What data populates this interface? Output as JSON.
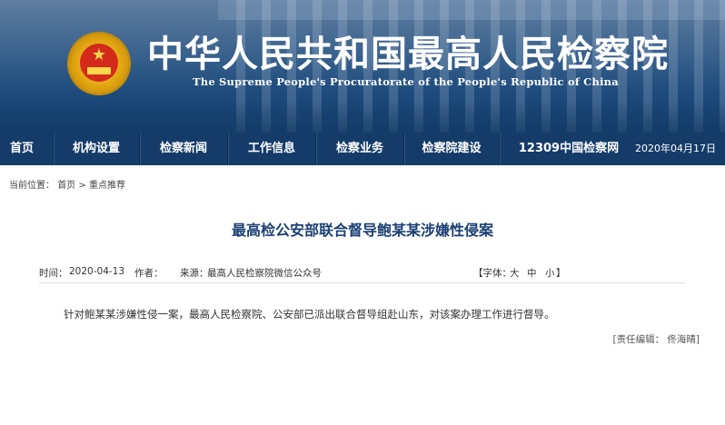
{
  "header": {
    "title": "中华人民共和国最高人民检察院",
    "subtitle": "The Supreme People's Procuratorate of the People's Republic of China",
    "emblem_icon": "procuratorate-emblem-icon"
  },
  "nav": {
    "items": [
      {
        "label": "首页"
      },
      {
        "label": "机构设置"
      },
      {
        "label": "检察新闻"
      },
      {
        "label": "工作信息"
      },
      {
        "label": "检察业务"
      },
      {
        "label": "检察院建设"
      },
      {
        "label": "12309中国检察网"
      }
    ],
    "date": "2020年04月17日"
  },
  "breadcrumb": {
    "prefix": "当前位置：",
    "home": "首页",
    "sep": ">",
    "current": "重点推荐"
  },
  "article": {
    "title": "最高检公安部联合督导鲍某某涉嫌性侵案",
    "time_label": "时间：",
    "time": "2020-04-13",
    "author_label": "作者：",
    "source_label": "来源：",
    "source": "最高人民检察院微信公众号",
    "font": {
      "open": "【字体：",
      "large": "大",
      "medium": "中",
      "small": "小",
      "close": "】"
    },
    "body": "针对鲍某某涉嫌性侵一案，最高人民检察院、公安部已派出联合督导组赴山东，对该案办理工作进行督导。",
    "editor": "[责任编辑： 佟海晴]"
  },
  "colors": {
    "nav_bg": "#153c69",
    "title_color": "#1b3f72"
  }
}
